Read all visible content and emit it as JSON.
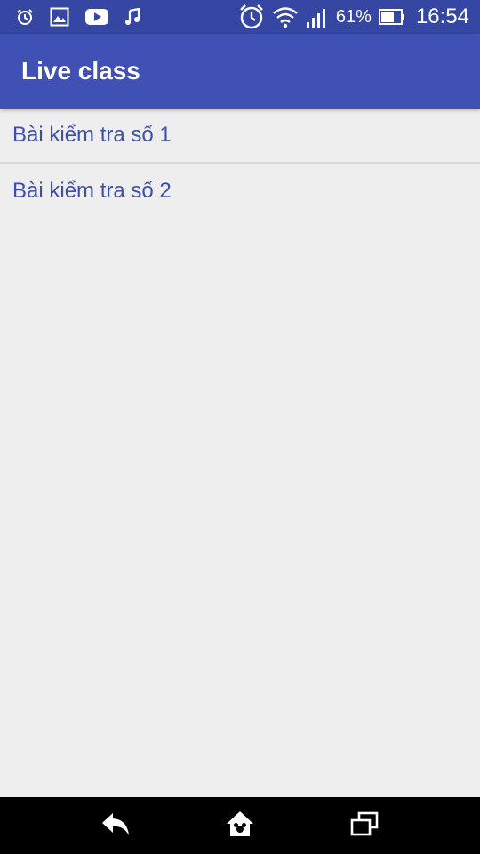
{
  "status_bar": {
    "left_icons": [
      "alarm-icon",
      "image-icon",
      "youtube-icon",
      "music-note-icon"
    ],
    "right_icons": [
      "alarm-icon",
      "wifi-icon",
      "signal-icon",
      "battery-icon"
    ],
    "battery": "61%",
    "time": "16:54"
  },
  "app_bar": {
    "title": "Live class"
  },
  "list": {
    "items": [
      {
        "label": "Bài kiểm tra số 1"
      },
      {
        "label": "Bài kiểm tra số 2"
      }
    ]
  },
  "nav_bar": {
    "buttons": [
      "back-icon",
      "home-icon",
      "recents-icon"
    ]
  },
  "colors": {
    "status_bar": "#3647a3",
    "app_bar": "#3f51b5",
    "list_text": "#3f4fad",
    "background": "#eeeeee",
    "nav_bar": "#000000"
  }
}
